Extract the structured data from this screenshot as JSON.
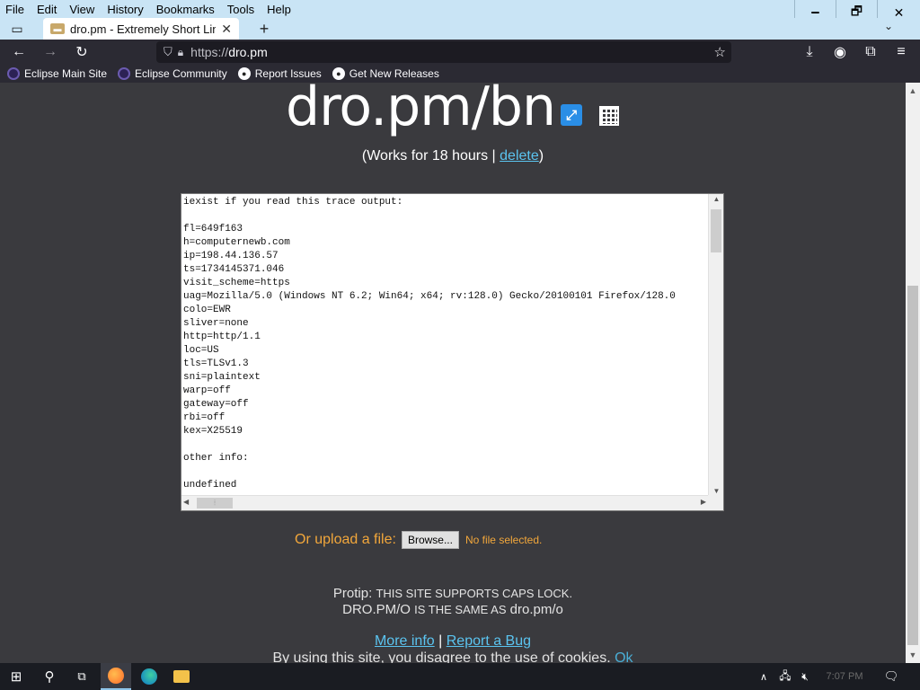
{
  "menubar": {
    "items": [
      "File",
      "Edit",
      "View",
      "History",
      "Bookmarks",
      "Tools",
      "Help"
    ]
  },
  "window_controls": {
    "minimize": "🗕",
    "maximize": "🗗",
    "close": "✕"
  },
  "tab": {
    "title": "dro.pm - Extremely Short Links",
    "close": "✕",
    "new_tab": "+"
  },
  "nav": {
    "url_scheme": "https://",
    "url_host": "dro.pm"
  },
  "bookmarks": [
    {
      "label": "Eclipse Main Site",
      "icon": "eclipse-icon"
    },
    {
      "label": "Eclipse Community",
      "icon": "eclipse-icon"
    },
    {
      "label": "Report Issues",
      "icon": "github-icon"
    },
    {
      "label": "Get New Releases",
      "icon": "github-icon"
    }
  ],
  "page": {
    "short_url": "dro.pm/bn",
    "works_prefix": "(Works for 18 hours | ",
    "delete_label": "delete",
    "works_suffix": ")",
    "trace_lines": [
      "iexist if you read this trace output:",
      "",
      "fl=649f163",
      "h=computernewb.com",
      "ip=198.44.136.57",
      "ts=1734145371.046",
      "visit_scheme=https",
      "uag=Mozilla/5.0 (Windows NT 6.2; Win64; x64; rv:128.0) Gecko/20100101 Firefox/128.0",
      "colo=EWR",
      "sliver=none",
      "http=http/1.1",
      "loc=US",
      "tls=TLSv1.3",
      "sni=plaintext",
      "warp=off",
      "gateway=off",
      "rbi=off",
      "kex=X25519",
      "",
      "other info:",
      "",
      "undefined"
    ],
    "upload_label": "Or upload a file:",
    "browse_label": "Browse...",
    "no_file": "No file selected.",
    "protip_label": "Protip:",
    "protip_text": "THIS SITE SUPPORTS CAPS LOCK.",
    "protip_line2_a": "DRO.PM/O",
    "protip_line2_b": "IS THE SAME AS",
    "protip_line2_c": "dro.pm/o",
    "more_info": "More info",
    "separator": "|",
    "report_bug": "Report a Bug",
    "cookie_text": "By using this site, you disagree to the use of cookies.",
    "cookie_ok": "Ok"
  },
  "taskbar": {
    "time": "7:07 PM"
  },
  "colors": {
    "page_bg": "#3a3a3e",
    "link": "#5bc4f0",
    "upload_accent": "#f2a73b",
    "chrome_bg": "#2b2a33",
    "titlebar_bg": "#c9e4f5"
  }
}
